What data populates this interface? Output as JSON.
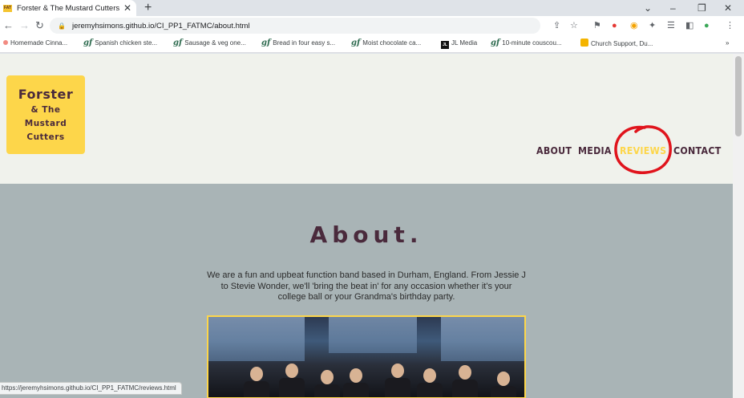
{
  "browser": {
    "tab_title": "Forster & The Mustard Cutters",
    "tab_favicon": "FAT",
    "url": "jeremyhsimons.github.io/CI_PP1_FATMC/about.html",
    "bookmarks": [
      {
        "label": "Homemade Cinna...",
        "icon": "dot-icon"
      },
      {
        "label": "Spanish chicken ste...",
        "icon": "gf-icon"
      },
      {
        "label": "Sausage & veg one...",
        "icon": "gf-icon"
      },
      {
        "label": "Bread in four easy s...",
        "icon": "gf-icon"
      },
      {
        "label": "Moist chocolate ca...",
        "icon": "gf-icon"
      },
      {
        "label": "JL Media",
        "icon": "jl-icon"
      },
      {
        "label": "10-minute couscou...",
        "icon": "gf-icon"
      },
      {
        "label": "Church Support, Du...",
        "icon": "church-icon"
      }
    ],
    "status_url": "https://jeremyhsimons.github.io/CI_PP1_FATMC/reviews.html"
  },
  "site": {
    "logo": {
      "line1": "Forster",
      "line2": "& The",
      "line3": "Mustard",
      "line4": "Cutters"
    },
    "nav": [
      {
        "label": "ABOUT"
      },
      {
        "label": "MEDIA"
      },
      {
        "label": "REVIEWS"
      },
      {
        "label": "CONTACT"
      }
    ],
    "about": {
      "title": "About.",
      "text": "We are a fun and upbeat function band based in Durham, England. From Jessie J to Stevie Wonder, we'll 'bring the beat in' for any occasion whether it's your college ball or your Grandma's birthday party."
    }
  },
  "colors": {
    "accent": "#fdd64a",
    "text_dark": "#4a2a3c",
    "header_bg": "#f0f2ec",
    "main_bg": "#a9b4b6",
    "annotation": "#e0141c"
  }
}
